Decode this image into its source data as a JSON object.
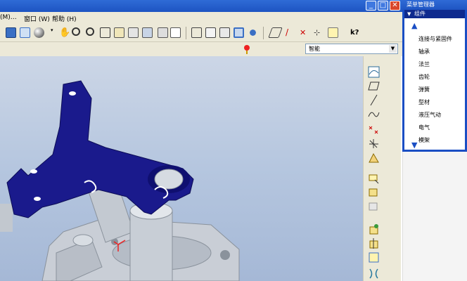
{
  "window": {
    "min_glyph": "_",
    "max_glyph": "□",
    "close_glyph": "✕"
  },
  "menubar": {
    "items": [
      "(M)…",
      "窗口 (W)",
      "帮助 (H)"
    ]
  },
  "toolbar2": {
    "filter_value": "智能"
  },
  "menu_manager": {
    "title": "菜单管理器",
    "section": "组件",
    "items": [
      "连接与紧固件",
      "轴承",
      "法兰",
      "齿轮",
      "弹簧",
      "型材",
      "液压气动",
      "电气",
      "模架"
    ]
  },
  "colors": {
    "titlebar": "#1e54c2",
    "chrome": "#ece9d8",
    "part_blue": "#1a1a8c",
    "part_grey": "#c8ced6",
    "viewport_top": "#ccd6e6",
    "viewport_bottom": "#a5b8d6"
  },
  "icons": {
    "toolbar": [
      "repaint-icon",
      "spin-center-icon",
      "display-style-icon",
      "pan-icon",
      "zoom-in-icon",
      "zoom-out-icon",
      "refit-icon",
      "reorient-icon",
      "saved-views-icon",
      "layers-icon",
      "view-manager-icon",
      "wireframe-icon",
      "hidden-line-icon",
      "no-hidden-icon",
      "shading-icon",
      "model-tree-icon",
      "datum-plane-icon",
      "datum-axis-icon",
      "datum-point-icon",
      "csys-icon",
      "annotation-icon",
      "help-icon"
    ],
    "right_toolbar": [
      "sketch-icon",
      "plane-icon",
      "axis-icon",
      "curve-icon",
      "point-icon",
      "coord-icon",
      "analysis-icon",
      "assemble-icon",
      "create-component-icon",
      "package-icon",
      "repeat-icon",
      "mirror-icon",
      "merge-icon",
      "datum-icon"
    ]
  }
}
